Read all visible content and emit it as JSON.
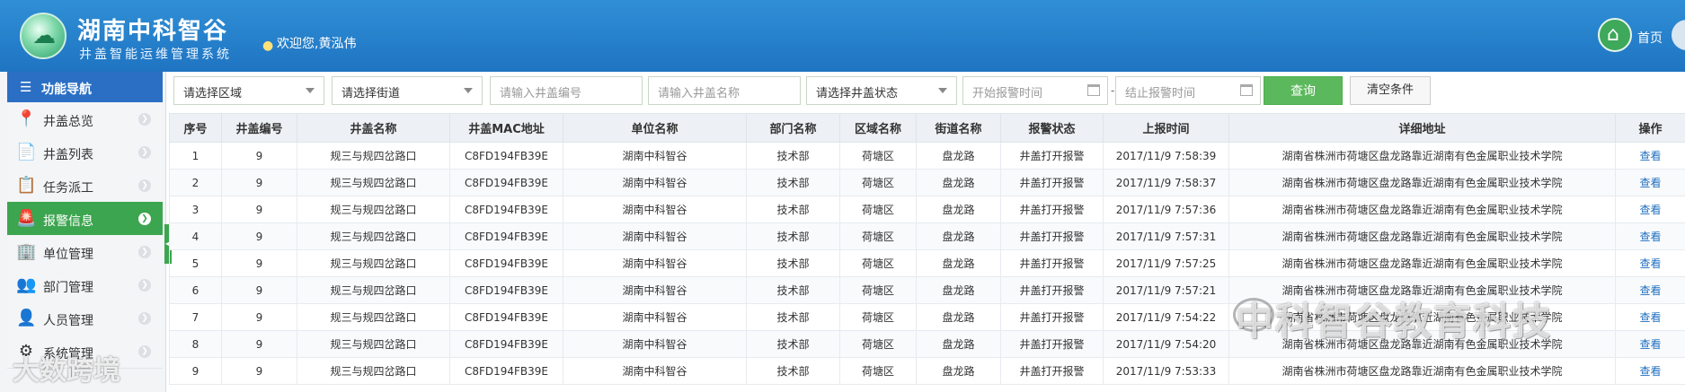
{
  "header": {
    "brand_title": "湖南中科智谷",
    "brand_subtitle": "井盖智能运维管理系统",
    "welcome": "欢迎您,黄泓伟",
    "home_label": "首页"
  },
  "sidebar": {
    "title": "功能导航",
    "items": [
      {
        "label": "井盖总览",
        "icon": "map-pin-icon",
        "glyph": "📍",
        "active": false
      },
      {
        "label": "井盖列表",
        "icon": "list-doc-icon",
        "glyph": "📄",
        "active": false
      },
      {
        "label": "任务派工",
        "icon": "clipboard-user-icon",
        "glyph": "📋",
        "active": false
      },
      {
        "label": "报警信息",
        "icon": "alarm-siren-icon",
        "glyph": "🚨",
        "active": true
      },
      {
        "label": "单位管理",
        "icon": "org-chart-icon",
        "glyph": "🏢",
        "active": false
      },
      {
        "label": "部门管理",
        "icon": "team-icon",
        "glyph": "👥",
        "active": false
      },
      {
        "label": "人员管理",
        "icon": "user-icon",
        "glyph": "👤",
        "active": false
      },
      {
        "label": "系统管理",
        "icon": "settings-icon",
        "glyph": "⚙",
        "active": false
      }
    ]
  },
  "filters": {
    "area_select": "请选择区域",
    "street_select": "请选择街道",
    "cover_no_placeholder": "请输入井盖编号",
    "cover_name_placeholder": "请输入井盖名称",
    "status_select": "请选择井盖状态",
    "start_time_placeholder": "开始报警时间",
    "separator": "-",
    "end_time_placeholder": "结止报警时间",
    "query_label": "查询",
    "clear_label": "清空条件"
  },
  "table": {
    "columns": [
      "序号",
      "井盖编号",
      "井盖名称",
      "井盖MAC地址",
      "单位名称",
      "部门名称",
      "区域名称",
      "街道名称",
      "报警状态",
      "上报时间",
      "详细地址",
      "操作"
    ],
    "rows": [
      [
        "1",
        "9",
        "规三与规四岔路口",
        "C8FD194FB39E",
        "湖南中科智谷",
        "技术部",
        "荷塘区",
        "盘龙路",
        "井盖打开报警",
        "2017/11/9 7:58:39",
        "湖南省株洲市荷塘区盘龙路靠近湖南有色金属职业技术学院",
        "查看"
      ],
      [
        "2",
        "9",
        "规三与规四岔路口",
        "C8FD194FB39E",
        "湖南中科智谷",
        "技术部",
        "荷塘区",
        "盘龙路",
        "井盖打开报警",
        "2017/11/9 7:58:37",
        "湖南省株洲市荷塘区盘龙路靠近湖南有色金属职业技术学院",
        "查看"
      ],
      [
        "3",
        "9",
        "规三与规四岔路口",
        "C8FD194FB39E",
        "湖南中科智谷",
        "技术部",
        "荷塘区",
        "盘龙路",
        "井盖打开报警",
        "2017/11/9 7:57:36",
        "湖南省株洲市荷塘区盘龙路靠近湖南有色金属职业技术学院",
        "查看"
      ],
      [
        "4",
        "9",
        "规三与规四岔路口",
        "C8FD194FB39E",
        "湖南中科智谷",
        "技术部",
        "荷塘区",
        "盘龙路",
        "井盖打开报警",
        "2017/11/9 7:57:31",
        "湖南省株洲市荷塘区盘龙路靠近湖南有色金属职业技术学院",
        "查看"
      ],
      [
        "5",
        "9",
        "规三与规四岔路口",
        "C8FD194FB39E",
        "湖南中科智谷",
        "技术部",
        "荷塘区",
        "盘龙路",
        "井盖打开报警",
        "2017/11/9 7:57:25",
        "湖南省株洲市荷塘区盘龙路靠近湖南有色金属职业技术学院",
        "查看"
      ],
      [
        "6",
        "9",
        "规三与规四岔路口",
        "C8FD194FB39E",
        "湖南中科智谷",
        "技术部",
        "荷塘区",
        "盘龙路",
        "井盖打开报警",
        "2017/11/9 7:57:21",
        "湖南省株洲市荷塘区盘龙路靠近湖南有色金属职业技术学院",
        "查看"
      ],
      [
        "7",
        "9",
        "规三与规四岔路口",
        "C8FD194FB39E",
        "湖南中科智谷",
        "技术部",
        "荷塘区",
        "盘龙路",
        "井盖打开报警",
        "2017/11/9 7:54:22",
        "湖南省株洲市荷塘区盘龙路靠近湖南有色金属职业技术学院",
        "查看"
      ],
      [
        "8",
        "9",
        "规三与规四岔路口",
        "C8FD194FB39E",
        "湖南中科智谷",
        "技术部",
        "荷塘区",
        "盘龙路",
        "井盖打开报警",
        "2017/11/9 7:54:20",
        "湖南省株洲市荷塘区盘龙路靠近湖南有色金属职业技术学院",
        "查看"
      ],
      [
        "9",
        "9",
        "规三与规四岔路口",
        "C8FD194FB39E",
        "湖南中科智谷",
        "技术部",
        "荷塘区",
        "盘龙路",
        "井盖打开报警",
        "2017/11/9 7:53:33",
        "湖南省株洲市荷塘区盘龙路靠近湖南有色金属职业技术学院",
        "查看"
      ]
    ]
  },
  "watermarks": {
    "right": "中科智谷教育科技",
    "left": "大数跨境"
  },
  "colors": {
    "header_blue": "#1f74c2",
    "nav_header_blue": "#2b6fc4",
    "active_green": "#3ca54f",
    "query_green": "#5cb85c",
    "link_blue": "#1f6fc0"
  }
}
